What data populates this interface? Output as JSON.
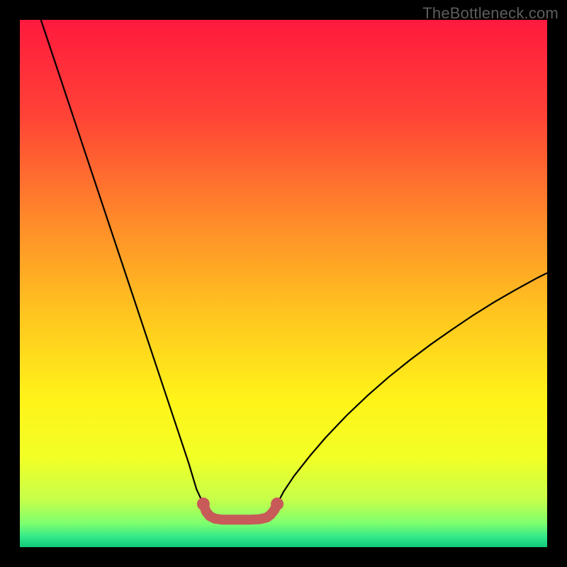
{
  "watermark": "TheBottleneck.com",
  "chart_data": {
    "type": "line",
    "title": "",
    "xlabel": "",
    "ylabel": "",
    "xlim": [
      0,
      100
    ],
    "ylim": [
      0,
      100
    ],
    "background_gradient_stops": [
      {
        "offset": 0.0,
        "color": "#ff1a3e"
      },
      {
        "offset": 0.18,
        "color": "#ff4236"
      },
      {
        "offset": 0.38,
        "color": "#ff8a2a"
      },
      {
        "offset": 0.56,
        "color": "#ffc61f"
      },
      {
        "offset": 0.72,
        "color": "#fff319"
      },
      {
        "offset": 0.83,
        "color": "#f2ff26"
      },
      {
        "offset": 0.91,
        "color": "#c6ff4a"
      },
      {
        "offset": 0.955,
        "color": "#7eff6e"
      },
      {
        "offset": 0.98,
        "color": "#33e98a"
      },
      {
        "offset": 1.0,
        "color": "#12c97a"
      }
    ],
    "series": [
      {
        "name": "left-branch",
        "color": "#000000",
        "x": [
          4.0,
          6,
          8,
          10,
          12,
          14,
          16,
          18,
          20,
          22,
          24,
          26,
          28,
          30,
          32,
          33.5,
          34.8
        ],
        "y": [
          100,
          94,
          88,
          82,
          76,
          70,
          64,
          58,
          52,
          46,
          40,
          34,
          28,
          22,
          16,
          11,
          8.2
        ]
      },
      {
        "name": "right-branch",
        "color": "#000000",
        "x": [
          48.8,
          50,
          52,
          55,
          58,
          62,
          66,
          70,
          74,
          78,
          82,
          86,
          90,
          94,
          98,
          100
        ],
        "y": [
          8.2,
          10.5,
          13.5,
          17.3,
          20.8,
          25.0,
          28.8,
          32.3,
          35.5,
          38.5,
          41.3,
          44.0,
          46.5,
          48.8,
          51.0,
          52.0
        ]
      },
      {
        "name": "trough-marker",
        "color": "#c85a5a",
        "x": [
          34.8,
          35.3,
          36.0,
          37.0,
          38.5,
          41.0,
          43.5,
          45.5,
          46.8,
          47.6,
          48.3,
          48.8
        ],
        "y": [
          8.2,
          6.8,
          5.9,
          5.4,
          5.2,
          5.2,
          5.2,
          5.3,
          5.6,
          6.2,
          7.1,
          8.2
        ]
      }
    ]
  }
}
